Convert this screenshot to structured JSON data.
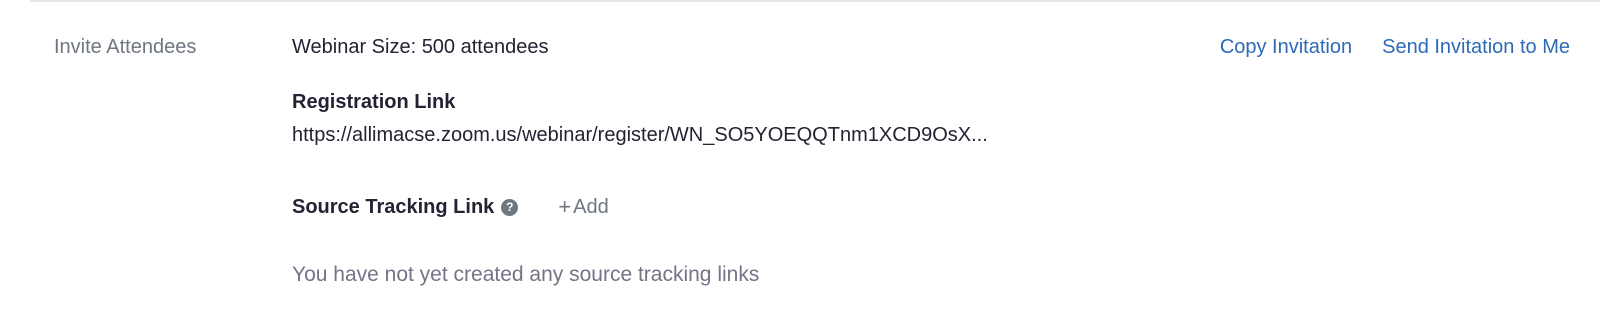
{
  "section": {
    "label": "Invite Attendees"
  },
  "webinar": {
    "size_text": "Webinar Size: 500 attendees"
  },
  "actions": {
    "copy_invitation": "Copy Invitation",
    "send_invitation": "Send Invitation to Me"
  },
  "registration": {
    "title": "Registration Link",
    "url": "https://allimacse.zoom.us/webinar/register/WN_SO5YOEQQTnm1XCD9OsX..."
  },
  "source_tracking": {
    "title": "Source Tracking Link",
    "help_icon": "?",
    "add_plus": "+",
    "add_label": "Add",
    "empty_message": "You have not yet created any source tracking links"
  },
  "colors": {
    "link": "#2d6ab8",
    "muted": "#6e7680",
    "text": "#232333"
  }
}
